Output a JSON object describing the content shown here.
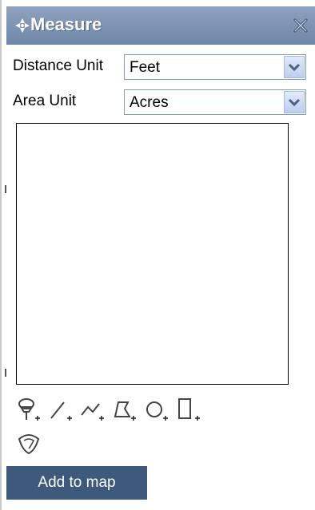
{
  "panel": {
    "title": "Measure",
    "title_icon": "compass-arrows-icon",
    "close_icon": "close-icon"
  },
  "form": {
    "distance_unit_label": "Distance Unit",
    "distance_unit_value": "Feet",
    "area_unit_label": "Area Unit",
    "area_unit_value": "Acres"
  },
  "tools": [
    {
      "icon": "point-pushpin-add-icon"
    },
    {
      "icon": "line-add-icon"
    },
    {
      "icon": "polyline-add-icon"
    },
    {
      "icon": "polygon-add-icon"
    },
    {
      "icon": "circle-add-icon"
    },
    {
      "icon": "rectangle-add-icon"
    },
    {
      "icon": "freehand-polygon-icon"
    }
  ],
  "actions": {
    "add_to_map_label": "Add to map"
  },
  "colors": {
    "titlebar": "#7b90b2",
    "button": "#3d5a7d",
    "select_border": "#7f9db9"
  }
}
